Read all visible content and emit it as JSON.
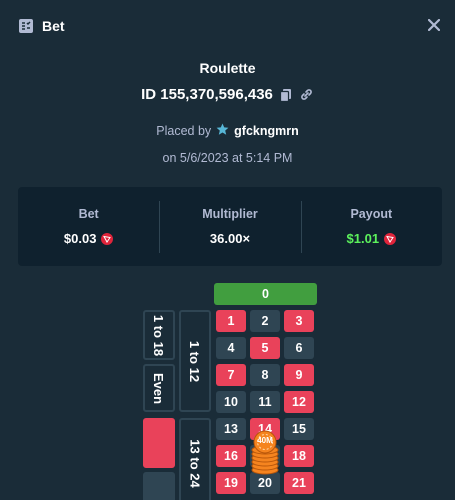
{
  "header": {
    "title": "Bet",
    "bet_icon": "bet-slip-icon",
    "close_icon": "close-icon"
  },
  "game": {
    "name": "Roulette"
  },
  "bet_id": {
    "text": "ID 155,370,596,436",
    "copy_icon": "copy-icon",
    "link_icon": "link-icon"
  },
  "placed_by": {
    "label": "Placed by",
    "username": "gfckngmrn",
    "badge_icon": "vip-star-icon"
  },
  "placed_on": "on 5/6/2023 at 5:14 PM",
  "stats": {
    "bet_label": "Bet",
    "bet_value": "$0.03",
    "multiplier_label": "Multiplier",
    "multiplier_value": "36.00×",
    "payout_label": "Payout",
    "payout_value": "$1.01",
    "currency_icon": "tron-coin-icon"
  },
  "colors": {
    "bg": "#1a2c38",
    "panel": "#0f212e",
    "red": "#e9425a",
    "black": "#2f4553",
    "green": "#419e3f",
    "payout_green": "#5cf25c"
  },
  "board": {
    "zero": "0",
    "numbers": [
      "1",
      "2",
      "3",
      "4",
      "5",
      "6",
      "7",
      "8",
      "9",
      "10",
      "11",
      "12",
      "13",
      "14",
      "15",
      "16",
      "17",
      "18",
      "19",
      "20",
      "21"
    ],
    "colors": [
      "red",
      "black",
      "red",
      "black",
      "red",
      "black",
      "red",
      "black",
      "red",
      "black",
      "black",
      "red",
      "black",
      "red",
      "black",
      "red",
      "black",
      "red",
      "red",
      "black",
      "red"
    ],
    "dozen_1": "1 to 12",
    "dozen_2": "13 to 24",
    "low": "1 to 18",
    "even": "Even",
    "chip_label": "40M"
  }
}
